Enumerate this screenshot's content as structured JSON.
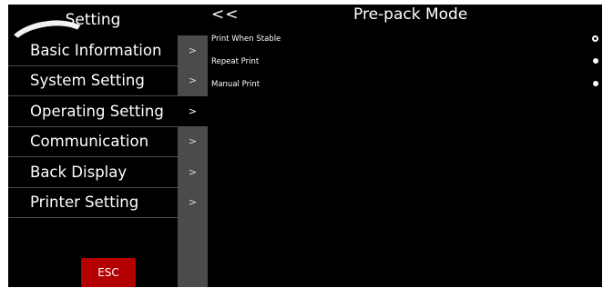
{
  "sidebar": {
    "title": "Setting",
    "items": [
      {
        "label": "Basic Information",
        "arrow": ">"
      },
      {
        "label": "System Setting",
        "arrow": ">"
      },
      {
        "label": "Operating Setting",
        "arrow": ">"
      },
      {
        "label": "Communication",
        "arrow": ">"
      },
      {
        "label": "Back Display",
        "arrow": ">"
      },
      {
        "label": "Printer Setting",
        "arrow": ">"
      }
    ],
    "esc_label": "ESC"
  },
  "main": {
    "back_label": "<<",
    "title": "Pre-pack Mode",
    "options": [
      {
        "label": "Print When Stable",
        "selected": true
      },
      {
        "label": "Repeat Print",
        "selected": false
      },
      {
        "label": "Manual Print",
        "selected": false
      }
    ]
  },
  "colors": {
    "background": "#000000",
    "sidebar_arrow_bg": "#4b4b4b",
    "esc_button": "#b30000"
  }
}
